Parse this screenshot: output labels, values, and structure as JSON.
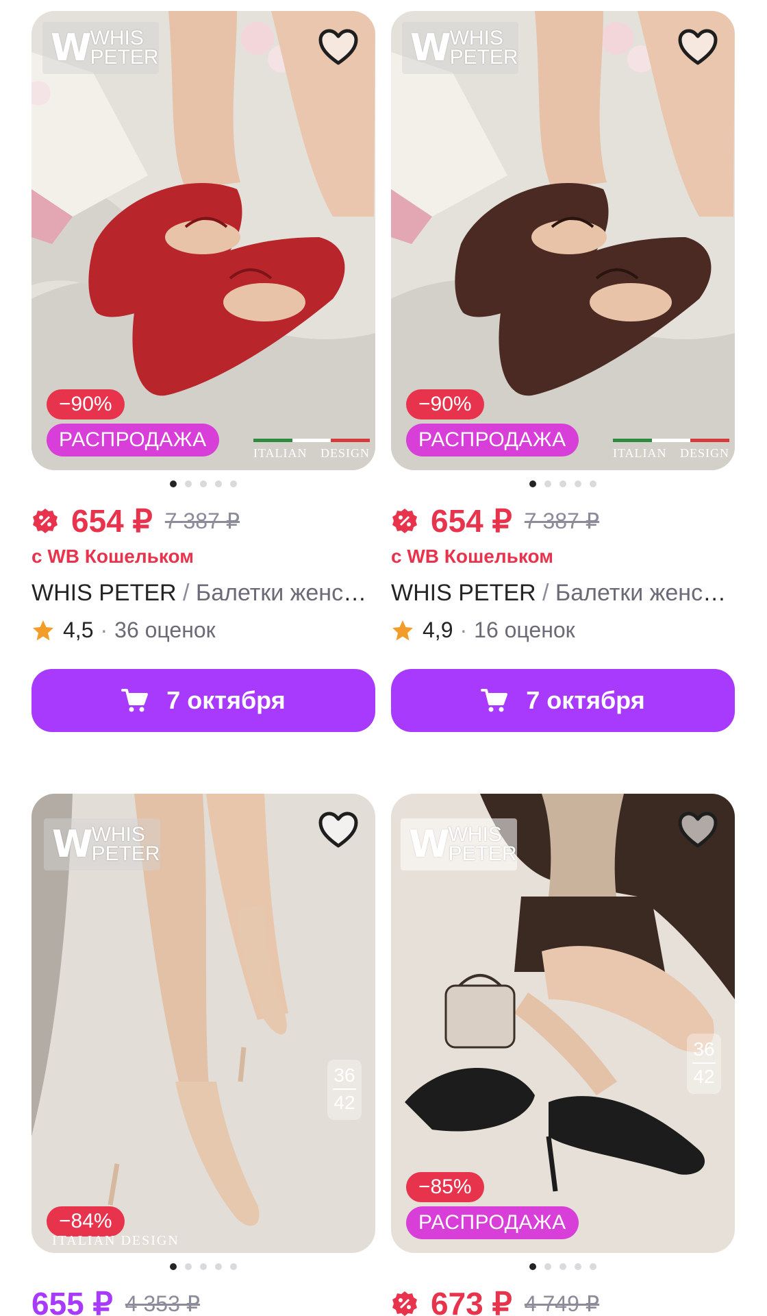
{
  "colors": {
    "accent_purple": "#a73afd",
    "price_red": "#e8334d",
    "sale_pink": "#d83ed8",
    "muted_text": "#8b8b99"
  },
  "products": [
    {
      "logo": {
        "mark": "W",
        "brand": "WHIS\nPETER"
      },
      "discount": "−90%",
      "sale_label": "РАСПРОДАЖА",
      "italian": {
        "left": "ITALIAN",
        "right": "DESIGN"
      },
      "price": "654 ₽",
      "old_price": "7 387 ₽",
      "wallet_label": "с WB Кошельком",
      "brand": "WHIS PETER",
      "name": "Балетки женские",
      "rating": "4,5",
      "reviews": "36 оценок",
      "delivery": "7 октября",
      "shoe_color": "#b8262c"
    },
    {
      "logo": {
        "mark": "W",
        "brand": "WHIS\nPETER"
      },
      "discount": "−90%",
      "sale_label": "РАСПРОДАЖА",
      "italian": {
        "left": "ITALIAN",
        "right": "DESIGN"
      },
      "price": "654 ₽",
      "old_price": "7 387 ₽",
      "wallet_label": "с WB Кошельком",
      "brand": "WHIS PETER",
      "name": "Балетки женские",
      "rating": "4,9",
      "reviews": "16 оценок",
      "delivery": "7 октября",
      "shoe_color": "#4a2a22"
    },
    {
      "logo": {
        "mark": "W",
        "brand": "WHIS\nPETER"
      },
      "discount": "−84%",
      "italian_caption": "ITALIAN DESIGN",
      "sizes": {
        "top": "36",
        "bottom": "42"
      },
      "price": "655 ₽",
      "old_price": "4 353 ₽"
    },
    {
      "logo": {
        "mark": "W",
        "brand": "WHIS\nPETER"
      },
      "discount": "−85%",
      "sale_label": "РАСПРОДАЖА",
      "sizes": {
        "top": "36",
        "bottom": "42"
      },
      "price": "673 ₽",
      "old_price": "4 749 ₽"
    }
  ]
}
